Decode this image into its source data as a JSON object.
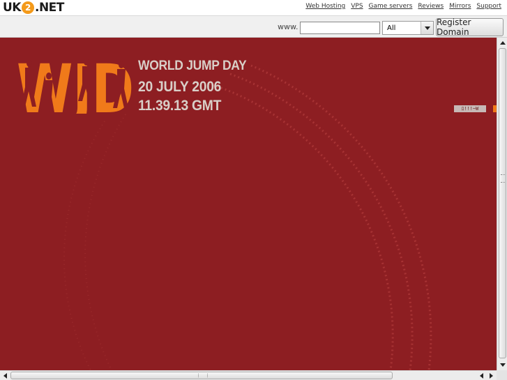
{
  "header": {
    "logo_left": "UK",
    "logo_mid": "2",
    "logo_right": ".NET",
    "nav": [
      {
        "label": "Web Hosting"
      },
      {
        "label": "VPS"
      },
      {
        "label": "Game servers"
      },
      {
        "label": "Reviews"
      },
      {
        "label": "Mirrors"
      },
      {
        "label": "Support"
      }
    ]
  },
  "domain_search": {
    "prefix_label": "www.",
    "input_value": "",
    "tld_selected": "All",
    "register_label": "Register Domain"
  },
  "content": {
    "headline_1": "WORLD JUMP DAY",
    "headline_2": "20 JULY 2006",
    "headline_3": "11.39.13 GMT",
    "logo_letters": "WJD",
    "side_tag": "ﾛ!!!~W",
    "colors": {
      "background": "#8d1e22",
      "logo_orange": "#f07a1a",
      "headline": "#d9cfc8",
      "arc": "#b33b3b"
    }
  }
}
